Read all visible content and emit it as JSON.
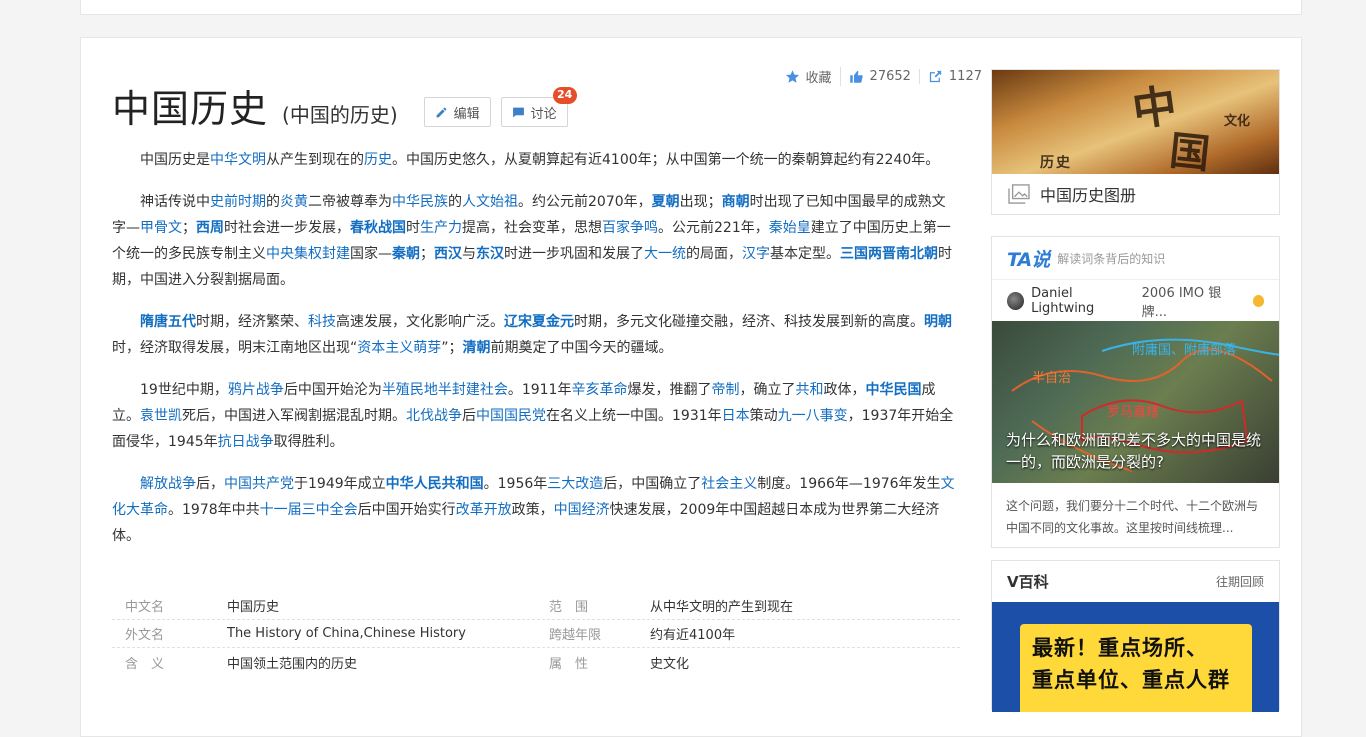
{
  "page": {
    "title": "中国历史",
    "subtitle": "(中国的历史)",
    "edit_label": "编辑",
    "discuss_label": "讨论",
    "discuss_count": "24"
  },
  "actions": {
    "collect_label": "收藏",
    "like_count": "27652",
    "share_count": "1127"
  },
  "paragraphs": [
    [
      {
        "t": "中国历史是"
      },
      {
        "l": "中华文明"
      },
      {
        "t": "从产生到现在的"
      },
      {
        "l": "历史"
      },
      {
        "t": "。中国历史悠久，从夏朝算起有近4100年；从中国第一个统一的秦朝算起约有2240年。"
      }
    ],
    [
      {
        "t": "神话传说中"
      },
      {
        "l": "史前时期"
      },
      {
        "t": "的"
      },
      {
        "l": "炎黄"
      },
      {
        "t": "二帝被尊奉为"
      },
      {
        "l": "中华民族"
      },
      {
        "t": "的"
      },
      {
        "l": "人文始祖"
      },
      {
        "t": "。约公元前2070年，"
      },
      {
        "b": "夏朝"
      },
      {
        "t": "出现；"
      },
      {
        "b": "商朝"
      },
      {
        "t": "时出现了已知中国最早的成熟文字—"
      },
      {
        "l": "甲骨文"
      },
      {
        "t": "；"
      },
      {
        "b": "西周"
      },
      {
        "t": "时社会进一步发展，"
      },
      {
        "b": "春秋战国"
      },
      {
        "t": "时"
      },
      {
        "l": "生产力"
      },
      {
        "t": "提高，社会变革，思想"
      },
      {
        "l": "百家争鸣"
      },
      {
        "t": "。公元前221年，"
      },
      {
        "l": "秦始皇"
      },
      {
        "t": "建立了中国历史上第一个统一的多民族专制主义"
      },
      {
        "l": "中央集权封建"
      },
      {
        "t": "国家—"
      },
      {
        "b": "秦朝"
      },
      {
        "t": "；"
      },
      {
        "b": "西汉"
      },
      {
        "t": "与"
      },
      {
        "b": "东汉"
      },
      {
        "t": "时进一步巩固和发展了"
      },
      {
        "l": "大一统"
      },
      {
        "t": "的局面，"
      },
      {
        "l": "汉字"
      },
      {
        "t": "基本定型。"
      },
      {
        "b": "三国两晋南北朝"
      },
      {
        "t": "时期，中国进入分裂割据局面。"
      }
    ],
    [
      {
        "b": "隋唐五代"
      },
      {
        "t": "时期，经济繁荣、"
      },
      {
        "l": "科技"
      },
      {
        "t": "高速发展，文化影响广泛。"
      },
      {
        "b": "辽宋夏金元"
      },
      {
        "t": "时期，多元文化碰撞交融，经济、科技发展到新的高度。"
      },
      {
        "b": "明朝"
      },
      {
        "t": "时，经济取得发展，明末江南地区出现“"
      },
      {
        "l": "资本主义萌芽"
      },
      {
        "t": "”；"
      },
      {
        "b": "清朝"
      },
      {
        "t": "前期奠定了中国今天的疆域。"
      }
    ],
    [
      {
        "t": "19世纪中期，"
      },
      {
        "l": "鸦片战争"
      },
      {
        "t": "后中国开始沦为"
      },
      {
        "l": "半殖民地半封建社会"
      },
      {
        "t": "。1911年"
      },
      {
        "l": "辛亥革命"
      },
      {
        "t": "爆发，推翻了"
      },
      {
        "l": "帝制"
      },
      {
        "t": "，确立了"
      },
      {
        "l": "共和"
      },
      {
        "t": "政体，"
      },
      {
        "b": "中华民国"
      },
      {
        "t": "成立。"
      },
      {
        "l": "袁世凯"
      },
      {
        "t": "死后，中国进入军阀割据混乱时期。"
      },
      {
        "l": "北伐战争"
      },
      {
        "t": "后"
      },
      {
        "l": "中国国民党"
      },
      {
        "t": "在名义上统一中国。1931年"
      },
      {
        "l": "日本"
      },
      {
        "t": "策动"
      },
      {
        "l": "九一八事变"
      },
      {
        "t": "，1937年开始全面侵华，1945年"
      },
      {
        "l": "抗日战争"
      },
      {
        "t": "取得胜利。"
      }
    ],
    [
      {
        "l": "解放战争"
      },
      {
        "t": "后，"
      },
      {
        "l": "中国共产党"
      },
      {
        "t": "于1949年成立"
      },
      {
        "b": "中华人民共和国"
      },
      {
        "t": "。1956年"
      },
      {
        "l": "三大改造"
      },
      {
        "t": "后，中国确立了"
      },
      {
        "l": "社会主义"
      },
      {
        "t": "制度。1966年—1976年发生"
      },
      {
        "l": "文化大革命"
      },
      {
        "t": "。1978年中共"
      },
      {
        "l": "十一届三中全会"
      },
      {
        "t": "后中国开始实行"
      },
      {
        "l": "改革开放"
      },
      {
        "t": "政策，"
      },
      {
        "l": "中国经济"
      },
      {
        "t": "快速发展，2009年中国超越日本成为世界第二大经济体。"
      }
    ]
  ],
  "infobox": [
    {
      "k1": "中文名",
      "v1": "中国历史",
      "k2": "范　围",
      "v2": "从中华文明的产生到现在"
    },
    {
      "k1": "外文名",
      "v1": "The History of China,Chinese History",
      "k2": "跨越年限",
      "v2": "约有近4100年"
    },
    {
      "k1": "含　义",
      "v1": "中国领土范围内的历史",
      "k2": "属　性",
      "v2": "史文化"
    }
  ],
  "album": {
    "caption": "中国历史图册",
    "image_text": [
      "中",
      "国",
      "文化",
      "历",
      "史"
    ]
  },
  "ta": {
    "logo": "TA说",
    "subtitle": "解读词条背后的知识",
    "author": "Daniel Lightwing",
    "author_desc": "2006 IMO 银牌...",
    "map_labels": [
      "附庸国、附庸部落",
      "半自治",
      "罗马直辖"
    ],
    "image_caption": "为什么和欧洲面积差不多大的中国是统一的，而欧洲是分裂的?",
    "desc": "这个问题，我们要分十二个时代、十二个欧洲与中国不同的文化事故。这里按时间线梳理..."
  },
  "vbaike": {
    "title": "V百科",
    "more": "往期回顾",
    "banner_lines": [
      "最新！重点场所、",
      "重点单位、重点人群"
    ]
  }
}
